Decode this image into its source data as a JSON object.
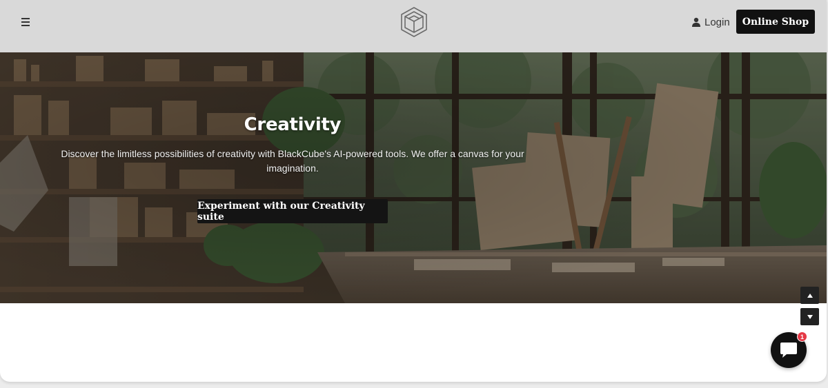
{
  "header": {
    "login_label": "Login",
    "shop_label": "Online Shop"
  },
  "hero": {
    "title": "Creativity",
    "description": "Discover the limitless possibilities of creativity with BlackCube's AI-powered tools. We offer a canvas for your imagination.",
    "cta_label": "Experiment with our Creativity suite"
  },
  "chat": {
    "unread_count": "1"
  },
  "icons": {
    "menu": "hamburger-menu-icon",
    "logo": "cube-logo",
    "login": "user-icon",
    "scroll_up": "triangle-up-icon",
    "scroll_down": "triangle-down-icon",
    "chat": "chat-bubble-icon"
  },
  "colors": {
    "header_bg": "#d9d9d9",
    "button_bg": "#111111",
    "badge": "#e53946"
  }
}
